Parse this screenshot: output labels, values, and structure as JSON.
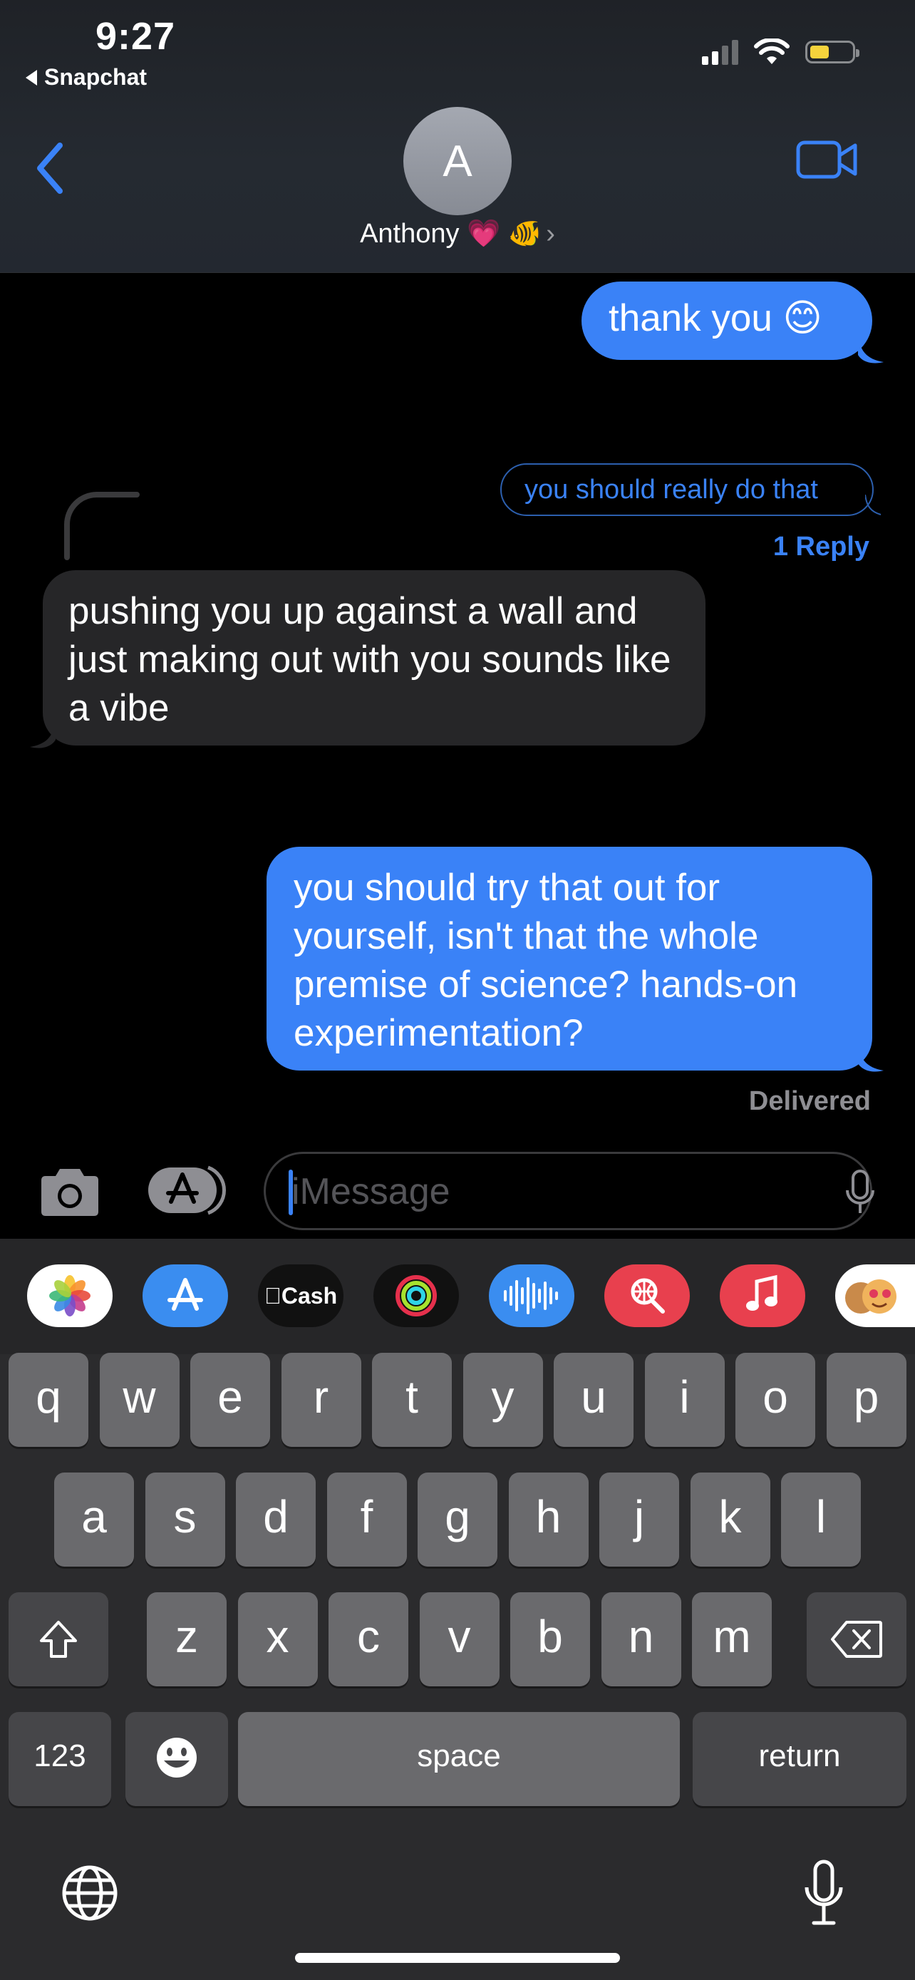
{
  "status_bar": {
    "time": "9:27",
    "back_app": "Snapchat"
  },
  "header": {
    "avatar_initial": "A",
    "contact_name": "Anthony 💗 🐠",
    "chevron": "›"
  },
  "messages": [
    {
      "id": "msg1",
      "direction": "outgoing",
      "text": "thank you 😊"
    },
    {
      "id": "msg2",
      "direction": "incoming",
      "text": "pushing you up against a wall and just making out with you sounds like a vibe"
    },
    {
      "id": "msg3",
      "direction": "outgoing",
      "text": "you should try that out for yourself, isn't that the whole premise of science? hands-on experimentation?"
    }
  ],
  "thread": {
    "reply_preview": "you should really do that",
    "reply_count": "1 Reply"
  },
  "delivered_label": "Delivered",
  "input": {
    "placeholder": "iMessage"
  },
  "app_strip": {
    "apps": [
      "photos-app",
      "app-store-app",
      "apple-cash-app",
      "activity-app",
      "audio-message-app",
      "image-search-app",
      "music-app",
      "memoji-app"
    ],
    "cash_label": "Cash"
  },
  "keyboard": {
    "row1": [
      "q",
      "w",
      "e",
      "r",
      "t",
      "y",
      "u",
      "i",
      "o",
      "p"
    ],
    "row2": [
      "a",
      "s",
      "d",
      "f",
      "g",
      "h",
      "j",
      "k",
      "l"
    ],
    "row3": [
      "z",
      "x",
      "c",
      "v",
      "b",
      "n",
      "m"
    ],
    "numbers_key": "123",
    "space_key": "space",
    "return_key": "return"
  },
  "colors": {
    "accent": "#3a82f7",
    "incoming_bubble": "#262628",
    "keyboard_bg": "#2b2b2d",
    "key": "#6a6a6d"
  }
}
